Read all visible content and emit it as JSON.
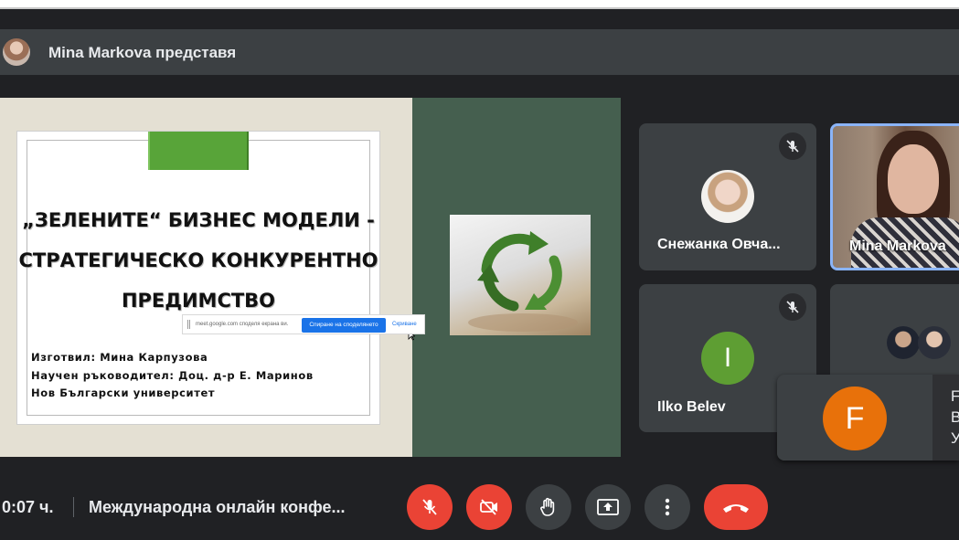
{
  "presenter": {
    "text": "Mina Markova представя"
  },
  "slide": {
    "title_lines": [
      "„ЗЕЛЕНИТЕ“ БИЗНЕС МОДЕЛИ -",
      "СТРАТЕГИЧЕСКО КОНКУРЕНТНО",
      "ПРЕДИМСТВО"
    ],
    "meta_lines": [
      "Изготвил: Мина Карпузова",
      "Научен ръководител: Доц. д-р Е. Маринов",
      "Нов Български университет"
    ]
  },
  "share_bar": {
    "text": "meet.google.com споделя екрана ви.",
    "stop_label": "Спиране на споделянето",
    "hide_label": "Скриване"
  },
  "participants": [
    {
      "name": "Снежанка Овча...",
      "muted": true
    },
    {
      "name": "Mina Markova",
      "active_speaker": true
    },
    {
      "name": "Ilko Belev",
      "initial": "I",
      "muted": true
    },
    {
      "name": ""
    }
  ],
  "popup": {
    "initial": "F",
    "lines": [
      "F",
      "B",
      "У"
    ]
  },
  "footer": {
    "time": "0:07 ч.",
    "meeting_title": "Международна онлайн конфе..."
  },
  "colors": {
    "danger": "#ea4335",
    "control": "#3c4043",
    "accent": "#8ab4f8",
    "avatar_i": "#5e9e33",
    "avatar_f": "#e8710a",
    "slide_green": "#58a439"
  },
  "icons": [
    "mic-off-icon",
    "camera-off-icon",
    "raise-hand-icon",
    "present-icon",
    "more-options-icon",
    "end-call-icon",
    "recycle-icon",
    "cursor-icon"
  ]
}
